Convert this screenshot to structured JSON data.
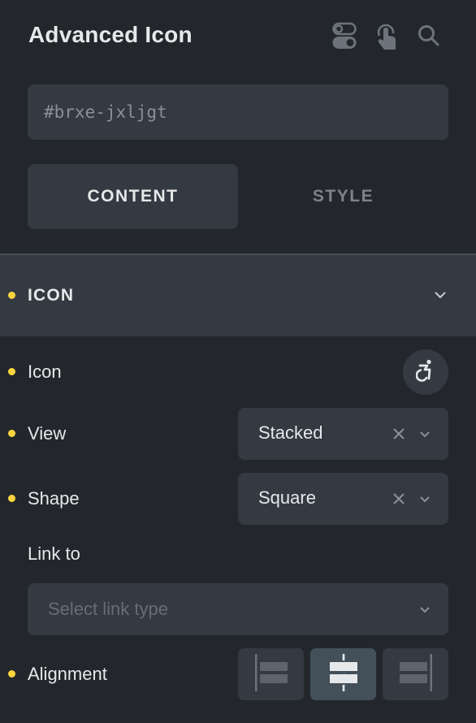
{
  "header": {
    "title": "Advanced Icon",
    "icons": [
      "toggles-icon",
      "hand-pointer-icon",
      "search-icon"
    ]
  },
  "element_id": {
    "placeholder": "#brxe-jxljgt",
    "value": ""
  },
  "tabs": [
    {
      "label": "CONTENT",
      "active": true
    },
    {
      "label": "STYLE",
      "active": false
    }
  ],
  "section": {
    "title": "ICON",
    "expanded": true
  },
  "controls": {
    "icon": {
      "label": "Icon",
      "value_icon": "wheelchair-accessible-icon"
    },
    "view": {
      "label": "View",
      "value": "Stacked"
    },
    "shape": {
      "label": "Shape",
      "value": "Square"
    },
    "link_to": {
      "label": "Link to",
      "placeholder": "Select link type"
    },
    "alignment": {
      "label": "Alignment",
      "options": [
        "left",
        "center",
        "right"
      ],
      "selected": "center"
    }
  },
  "colors": {
    "background": "#23272b",
    "panel": "#343a41",
    "accent_dot": "#ffd53e",
    "active_align": "#43505a"
  }
}
